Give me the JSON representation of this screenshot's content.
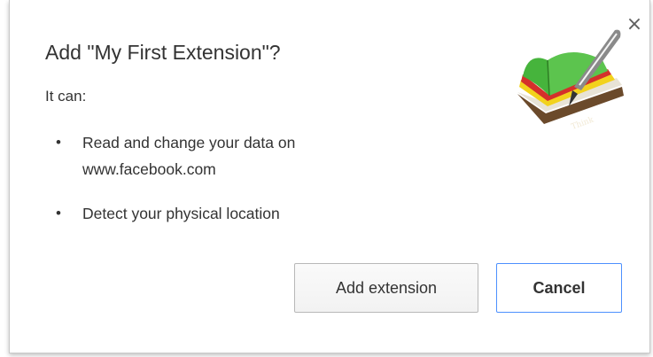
{
  "dialog": {
    "title": "Add \"My First Extension\"?",
    "intro": "It can:",
    "permissions": [
      {
        "bullet": "•",
        "lines": [
          "Read and change your data on",
          "www.facebook.com"
        ]
      },
      {
        "bullet": "•",
        "lines": [
          "Detect your physical location"
        ]
      }
    ],
    "close_label": "×",
    "icon_text": "Think",
    "buttons": {
      "add_label": "Add extension",
      "cancel_label": "Cancel"
    }
  },
  "icons": {
    "close": "close-icon",
    "extension": "extension-book-quill-icon"
  },
  "colors": {
    "focus_border": "#4d90fe",
    "text": "#333333",
    "book_green": "#46b43c",
    "book_red": "#d4302b",
    "book_yellow": "#f2d21d"
  }
}
